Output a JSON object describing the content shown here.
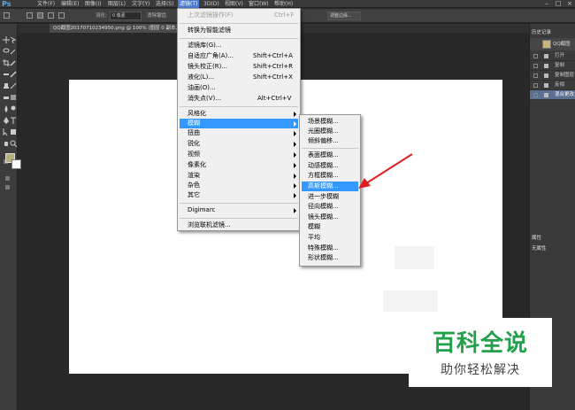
{
  "app": {
    "logo": "Ps"
  },
  "menubar": {
    "items": [
      "文件(F)",
      "编辑(E)",
      "图像(I)",
      "图层(L)",
      "文字(Y)",
      "选择(S)",
      "滤镜(T)",
      "3D(D)",
      "视图(V)",
      "窗口(W)",
      "帮助(H)"
    ],
    "active_index": 6
  },
  "options_bar": {
    "feather_label": "羽化:",
    "feather_value": "0 像素",
    "antialias_label": "消除锯齿",
    "refine_label": "调整边缘..."
  },
  "document": {
    "tab_title": "QQ截图20170710234950.png @ 100% (图层 0 副本, RGB/8#) *"
  },
  "history_panel": {
    "title": "历史记录",
    "snapshot": "QQ截图",
    "items": [
      "打开",
      "复制",
      "复制图层",
      "反相",
      "混合更改"
    ],
    "selected_index": 4
  },
  "properties_panel": {
    "title": "属性",
    "empty_text": "无属性"
  },
  "filter_menu": {
    "items": [
      {
        "label": "上次滤镜操作(F)",
        "shortcut": "Ctrl+F",
        "disabled": true
      },
      {
        "label": "转换为智能滤镜"
      },
      {
        "label": "滤镜库(G)..."
      },
      {
        "label": "自适应广角(A)...",
        "shortcut": "Shift+Ctrl+A"
      },
      {
        "label": "镜头校正(R)...",
        "shortcut": "Shift+Ctrl+R"
      },
      {
        "label": "液化(L)...",
        "shortcut": "Shift+Ctrl+X"
      },
      {
        "label": "油画(O)..."
      },
      {
        "label": "消失点(V)...",
        "shortcut": "Alt+Ctrl+V"
      },
      {
        "label": "风格化",
        "submenu": true
      },
      {
        "label": "模糊",
        "submenu": true,
        "highlighted": true
      },
      {
        "label": "扭曲",
        "submenu": true
      },
      {
        "label": "锐化",
        "submenu": true
      },
      {
        "label": "视频",
        "submenu": true
      },
      {
        "label": "像素化",
        "submenu": true
      },
      {
        "label": "渲染",
        "submenu": true
      },
      {
        "label": "杂色",
        "submenu": true
      },
      {
        "label": "其它",
        "submenu": true
      },
      {
        "label": "Digimarc",
        "submenu": true
      },
      {
        "label": "浏览联机滤镜..."
      }
    ]
  },
  "blur_submenu": {
    "items": [
      {
        "label": "场景模糊..."
      },
      {
        "label": "光圈模糊..."
      },
      {
        "label": "倾斜偏移..."
      },
      {
        "label": "表面模糊..."
      },
      {
        "label": "动感模糊..."
      },
      {
        "label": "方框模糊..."
      },
      {
        "label": "高斯模糊...",
        "highlighted": true
      },
      {
        "label": "进一步模糊"
      },
      {
        "label": "径向模糊..."
      },
      {
        "label": "镜头模糊..."
      },
      {
        "label": "模糊"
      },
      {
        "label": "平均"
      },
      {
        "label": "特殊模糊..."
      },
      {
        "label": "形状模糊..."
      }
    ]
  },
  "watermark": {
    "title": "百科全说",
    "subtitle": "助你轻松解决"
  },
  "colors": {
    "highlight": "#3399ff",
    "annotation_arrow": "#e02020",
    "watermark_green": "#22a04b",
    "foreground_swatch": "#b5b078"
  }
}
